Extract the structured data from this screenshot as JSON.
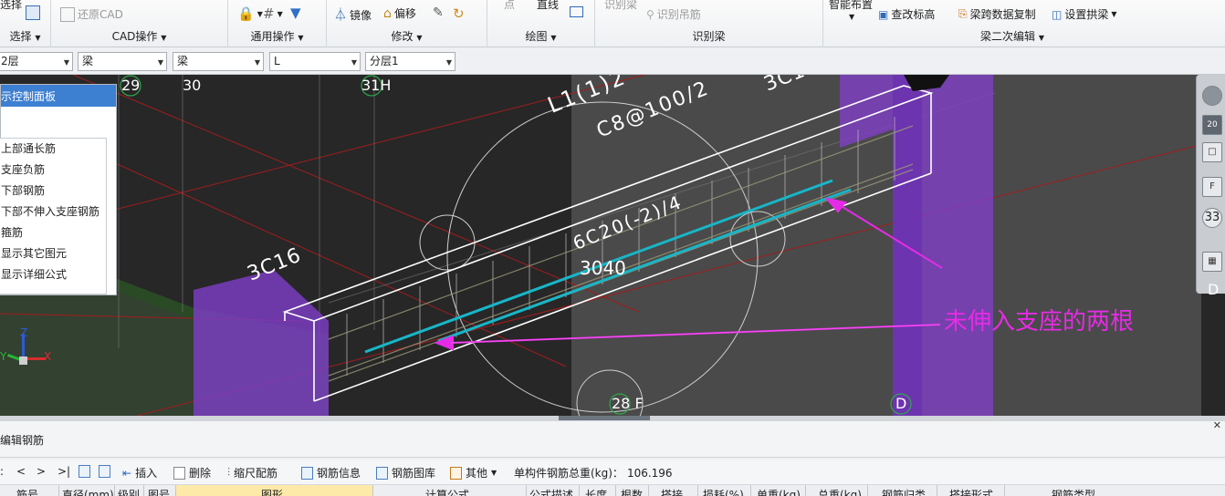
{
  "ribbon": {
    "select_partial": "选择",
    "select_label": "选择",
    "restore_cad": "还原CAD",
    "cad_ops": "CAD操作",
    "general_ops": "通用操作",
    "mirror": "镜像",
    "offset": "偏移",
    "modify": "修改",
    "point": "点",
    "line": "直线",
    "draw": "绘图",
    "identify_beam_top": "识别梁",
    "identify_stirrup": "识别吊筋",
    "identify_beam": "识别梁",
    "smart_layout": "智能布置",
    "change_elevation": "查改标高",
    "span_copy": "梁跨数据复制",
    "set_arch": "设置拱梁",
    "beam_secondary": "梁二次编辑"
  },
  "filters": {
    "floor": "2层",
    "category": "梁",
    "type": "梁",
    "name": "L",
    "sublayer": "分层1"
  },
  "viewport": {
    "control_panel": {
      "title": "示控制面板",
      "items": [
        "上部通长筋",
        "支座负筋",
        "下部钢筋",
        "下部不伸入支座钢筋",
        "箍筋",
        "显示其它图元",
        "显示详细公式"
      ]
    },
    "axis_labels": {
      "a29": "29",
      "a30": "30",
      "a31h": "31H",
      "a28f": "28 F",
      "ad": "D"
    },
    "beam_text": {
      "left_3c16": "3C16",
      "top_3c16": "3C16",
      "beam_name": "L1(1)2",
      "stirrup": "C8@100/2",
      "bottom_bars": "6C20(-2)/4",
      "length": "3040"
    },
    "annotation": "未伸入支座的两根",
    "right_tools": {
      "level": "20",
      "num": "33",
      "letter": "D"
    },
    "triad": {
      "x": "X",
      "y": "Y",
      "z": "Z"
    },
    "colors": {
      "background": "#272727",
      "annotation": "#e62be6",
      "rebar": "#17b6c8",
      "column": "#8a3fc7",
      "beam_edge": "#ffffff"
    }
  },
  "bottom": {
    "title": "编辑钢筋",
    "nav": [
      ":",
      "<",
      ">",
      ">|"
    ],
    "insert": "插入",
    "delete": "删除",
    "scale_rebar": "缩尺配筋",
    "rebar_info": "钢筋信息",
    "rebar_lib": "钢筋图库",
    "other": "其他",
    "total_weight_label": "单构件钢筋总重(kg)：",
    "total_weight_value": "106.196",
    "columns": [
      "筋号",
      "直径(mm)",
      "级别",
      "图号",
      "图形",
      "计算公式",
      "公式描述",
      "长度",
      "根数",
      "搭接",
      "损耗(%)",
      "单重(kg)",
      "总重(kg)",
      "钢筋归类",
      "搭接形式",
      "钢筋类型"
    ]
  }
}
